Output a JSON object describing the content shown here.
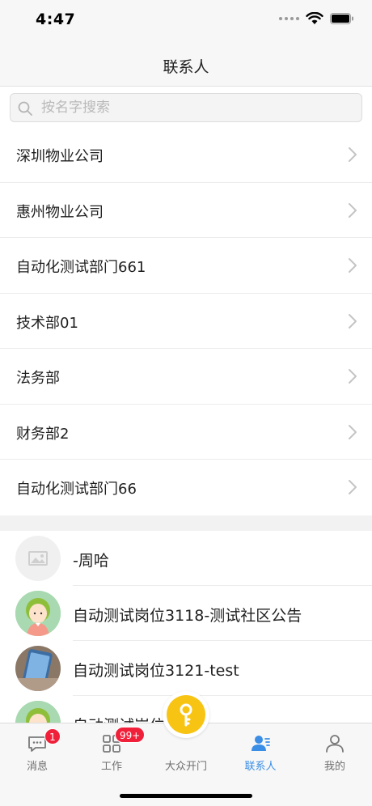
{
  "status_bar": {
    "time": "4:47"
  },
  "nav": {
    "title": "联系人"
  },
  "search": {
    "placeholder": "按名字搜索",
    "value": ""
  },
  "departments": [
    {
      "label": "深圳物业公司"
    },
    {
      "label": "惠州物业公司"
    },
    {
      "label": "自动化测试部门661"
    },
    {
      "label": "技术部01"
    },
    {
      "label": "法务部"
    },
    {
      "label": "财务部2"
    },
    {
      "label": "自动化测试部门66"
    }
  ],
  "contacts": [
    {
      "name": "-周哈",
      "avatar": "placeholder-image"
    },
    {
      "name": "自动测试岗位3118-测试社区公告",
      "avatar": "cartoon-girl"
    },
    {
      "name": "自动测试岗位3121-test",
      "avatar": "photo"
    },
    {
      "name": "自动测试岗位",
      "avatar": "cartoon-girl"
    }
  ],
  "tabs": [
    {
      "label": "消息",
      "icon": "message-icon",
      "badge": "1"
    },
    {
      "label": "工作",
      "icon": "grid-icon",
      "badge": "99+"
    },
    {
      "label": "大众开门",
      "icon": "key-icon"
    },
    {
      "label": "联系人",
      "icon": "contacts-icon",
      "active": true
    },
    {
      "label": "我的",
      "icon": "person-icon"
    }
  ],
  "colors": {
    "accent": "#3a8ee6",
    "badge": "#f0203a",
    "open_door": "#f8c414"
  }
}
